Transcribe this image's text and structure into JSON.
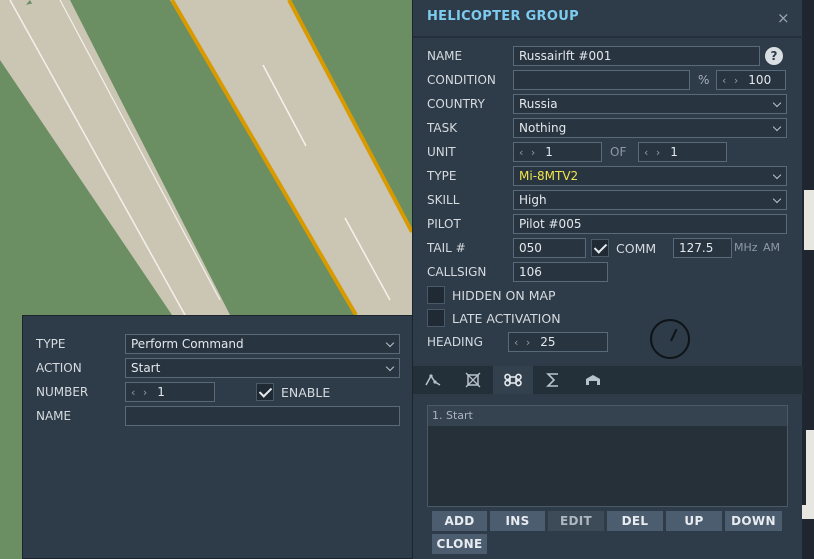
{
  "panel": {
    "title": "HELICOPTER GROUP",
    "close_glyph": "×",
    "help_glyph": "?",
    "labels": {
      "name": "NAME",
      "condition": "CONDITION",
      "country": "COUNTRY",
      "task": "TASK",
      "unit": "UNIT",
      "of": "OF",
      "type": "TYPE",
      "skill": "SKILL",
      "pilot": "PILOT",
      "tail": "TAIL #",
      "comm": "COMM",
      "callsign": "CALLSIGN",
      "hidden_on_map": "HIDDEN ON MAP",
      "late_activation": "LATE ACTIVATION",
      "heading": "HEADING"
    },
    "values": {
      "name": "Russairlft #001",
      "condition_text": "",
      "condition_pct": "%",
      "condition_value": "100",
      "country": "Russia",
      "task": "Nothing",
      "unit": "1",
      "unit_of": "1",
      "type": "Mi-8MTV2",
      "skill": "High",
      "pilot": "Pilot #005",
      "tail": "050",
      "comm_checked": true,
      "comm_freq": "127.5",
      "comm_unit": "MHz",
      "comm_mod": "AM",
      "callsign": "106",
      "hidden_on_map": false,
      "late_activation": false,
      "heading": "25"
    },
    "spin_arrows": "‹ ›",
    "tabs": [
      {
        "name": "route-tab",
        "icon": "route-icon",
        "active": false
      },
      {
        "name": "target-tab",
        "icon": "target-icon",
        "active": false
      },
      {
        "name": "actions-tab",
        "icon": "command-icon",
        "active": true
      },
      {
        "name": "summary-tab",
        "icon": "sigma-icon",
        "active": false
      },
      {
        "name": "payload-tab",
        "icon": "hangar-icon",
        "active": false
      }
    ],
    "actions": [
      "1. Start"
    ],
    "buttons": {
      "add": "ADD",
      "ins": "INS",
      "edit": "EDIT",
      "del": "DEL",
      "up": "UP",
      "down": "DOWN",
      "clone": "CLONE"
    }
  },
  "command": {
    "labels": {
      "type": "TYPE",
      "action": "ACTION",
      "number": "NUMBER",
      "enable": "ENABLE",
      "name": "NAME"
    },
    "values": {
      "type": "Perform Command",
      "action": "Start",
      "number": "1",
      "enable": true,
      "name": ""
    }
  },
  "colors": {
    "panel_bg": "#2e3b48",
    "title": "#7ecbf0",
    "type_highlight": "#f0e64a",
    "map_grass": "#6b8f63",
    "runway": "#cbc6b4",
    "runway_edge": "#e0a400"
  }
}
